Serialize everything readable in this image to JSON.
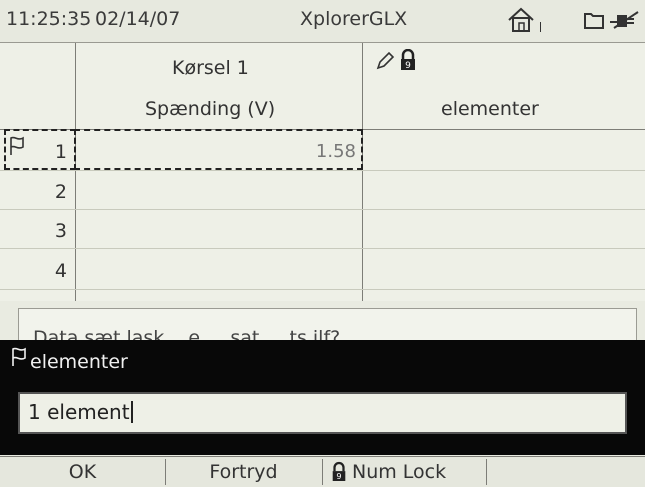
{
  "status": {
    "time": "11:25:35",
    "date": "02/14/07",
    "app_title": "XplorerGLX",
    "icons": [
      "home-icon",
      "folder-icon",
      "plug-icon"
    ]
  },
  "table": {
    "col1_header_top": "Kørsel 1",
    "col1_header_bottom": "Spænding (V)",
    "col2_header_bottom": "elementer",
    "col2_header_icons": [
      "pencil-icon",
      "lock-icon"
    ],
    "rows": [
      {
        "num": "1",
        "value": "1.58"
      },
      {
        "num": "2",
        "value": ""
      },
      {
        "num": "3",
        "value": ""
      },
      {
        "num": "4",
        "value": ""
      }
    ]
  },
  "dialog": {
    "behind_text": "Data sæt lask ...e ... sat ... ts ilf?",
    "title": "elementer",
    "input_value": "1 element"
  },
  "softkeys": {
    "ok": "OK",
    "cancel": "Fortryd",
    "numlock": "Num Lock"
  },
  "colors": {
    "background": "#e9ebe1",
    "dark_panel": "#080808"
  }
}
